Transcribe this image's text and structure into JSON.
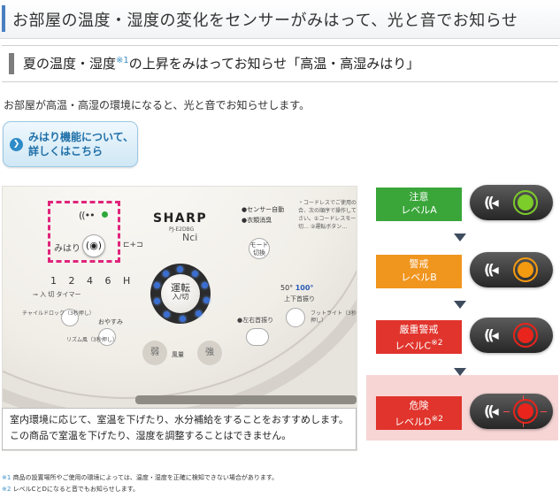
{
  "header": {
    "title": "お部屋の温度・湿度の変化をセンサーがみはって、光と音でお知らせ"
  },
  "subheading": {
    "text": "夏の温度・湿度",
    "note_mark": "※1",
    "text_after": "の上昇をみはってお知らせ「高温・高湿みはり」"
  },
  "intro": "お部屋が高温・高湿の環境になると、光と音でお知らせします。",
  "more_button": {
    "line1": "みはり機能について、",
    "line2": "詳しくはこちら"
  },
  "device": {
    "mimamori_label": "みはり",
    "mimamori_button": "(◉)",
    "ws_indicator": "((••",
    "brand": "SHARP",
    "model": "PJ-E2DBG",
    "nci": "Nci",
    "sensor_items": [
      "●センサー自動",
      "●衣類消臭"
    ],
    "cordless_text": "・コードレスでご使用の場合、次の順序で操作してください。①コードレスモード切… ②運転ボタン…",
    "mode_button": "モード切換",
    "timer_digits": "1 2 4 6 H",
    "timer_sub": "入 切 タイマー",
    "childlock": "チャイルドロック（3秒押し）",
    "oyasumi": "おやすみ",
    "rhythm": "リズム風（3秒押し）",
    "power_main": "運転",
    "power_sub": "入/切",
    "fuuryou": "風量",
    "weak": "弱",
    "strong": "強",
    "angle_50": "50°",
    "angle_100": "100°",
    "angle_sub": "上下首振り",
    "footlight": "フットライト（3秒押し）",
    "lr_swing": "●左右首振り"
  },
  "note": {
    "line1": "室内環境に応じて、室温を下げたり、水分補給をすることをおすすめします。",
    "line2": "この商品で室温を下げたり、湿度を調整することはできません。"
  },
  "levels": [
    {
      "title": "注意",
      "level": "レベルA",
      "note": "",
      "color": "#3aa63a",
      "led": "#7ccc2a"
    },
    {
      "title": "警戒",
      "level": "レベルB",
      "note": "",
      "color": "#f0951e",
      "led": "#f49a10"
    },
    {
      "title": "厳重警戒",
      "level": "レベルC",
      "note": "※2",
      "color": "#e0342c",
      "led": "#e8241c"
    },
    {
      "title": "危険",
      "level": "レベルD",
      "note": "※2",
      "color": "#e0342c",
      "led": "#e8241c"
    }
  ],
  "footnotes": [
    {
      "mark": "※1",
      "text": "商品の設置場所やご使用の環境によっては、温度・湿度を正確に検知できない場合があります。"
    },
    {
      "mark": "※2",
      "text": "レベルCとDになると音でもお知らせします。"
    }
  ],
  "colors": {
    "accent": "#4a7fc0",
    "link": "#1f6fa8",
    "highlight": "#e0247b",
    "danger_bg": "#f7d5d5"
  }
}
